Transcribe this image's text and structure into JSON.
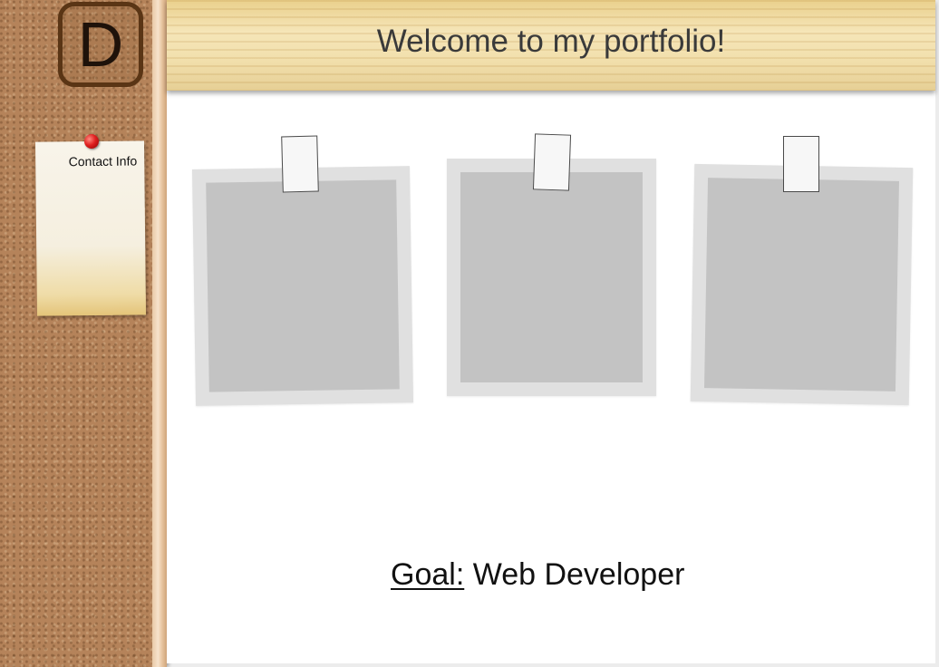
{
  "logo": {
    "letter": "D"
  },
  "sidebar": {
    "contact_label": "Contact Info"
  },
  "header": {
    "title": "Welcome to my portfolio!"
  },
  "goal": {
    "label": "Goal:",
    "value": " Web Developer"
  },
  "photos": [
    {
      "name": "photo-card-1"
    },
    {
      "name": "photo-card-2"
    },
    {
      "name": "photo-card-3"
    }
  ]
}
